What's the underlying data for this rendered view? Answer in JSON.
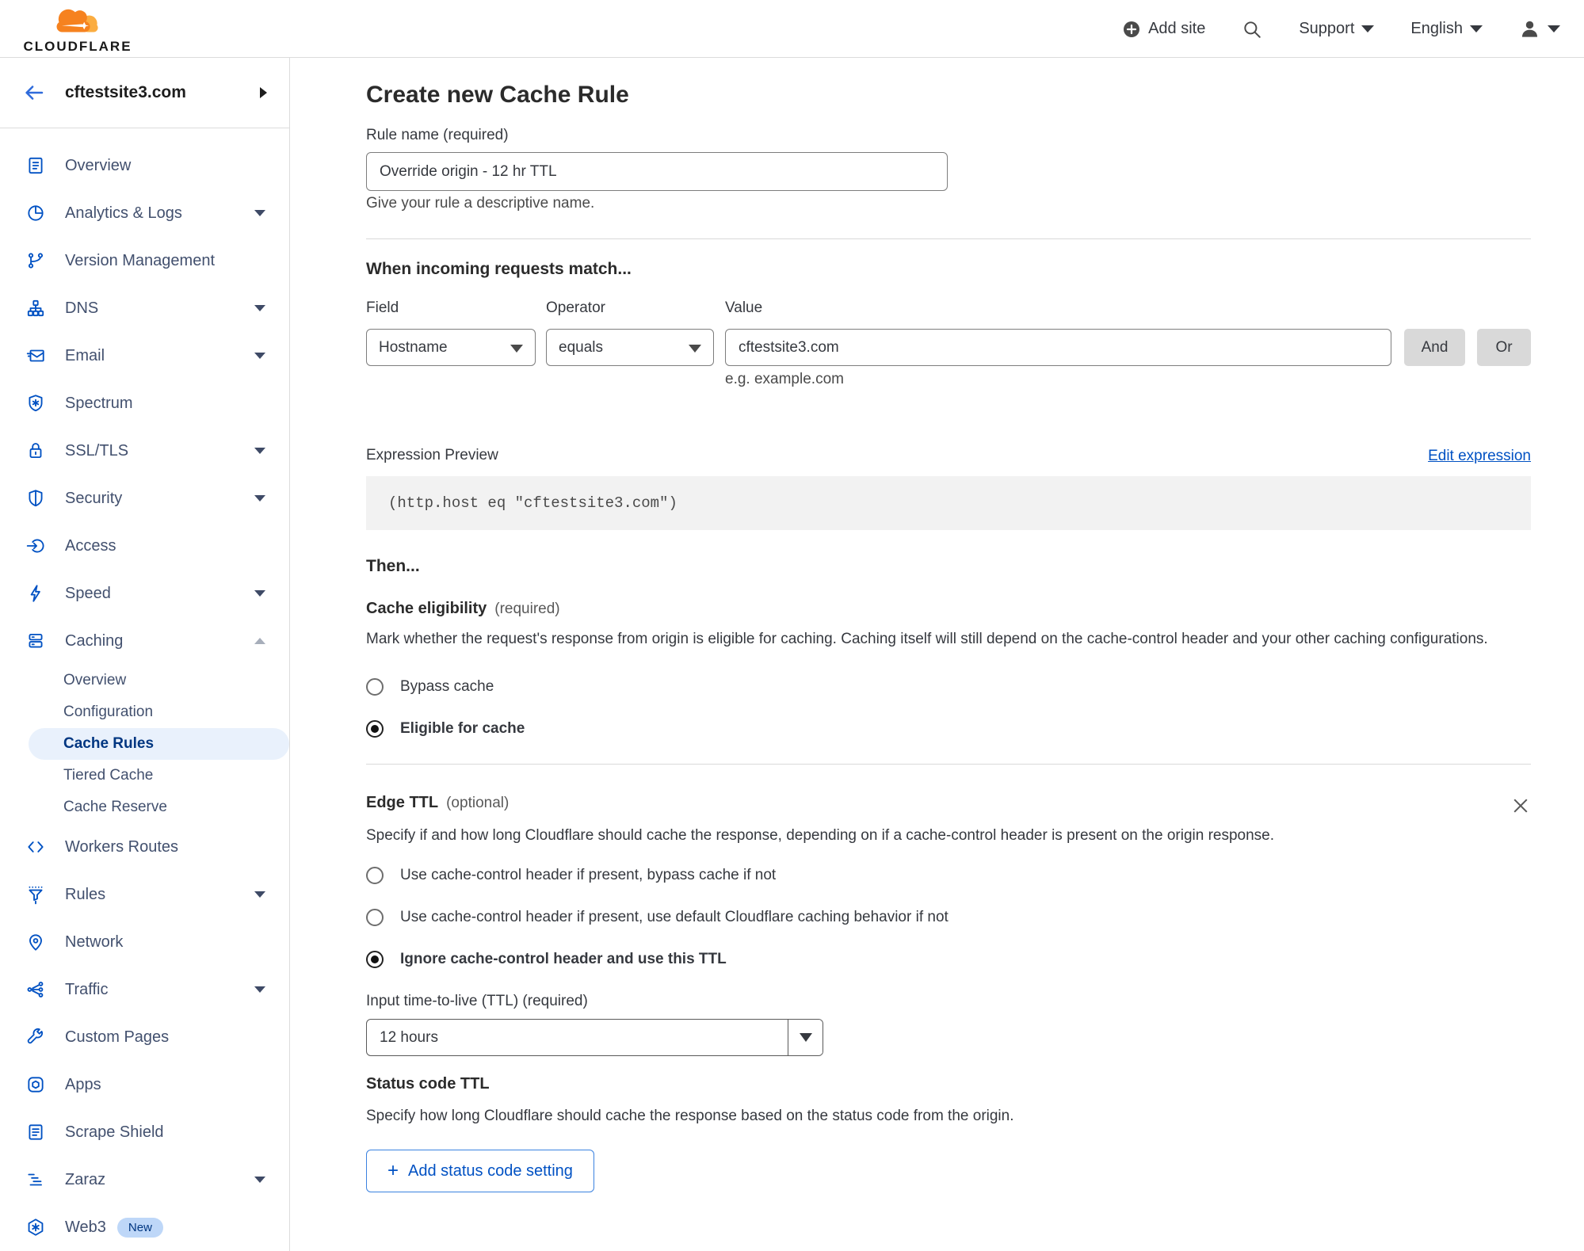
{
  "header": {
    "logo_text": "CLOUDFLARE",
    "add_site_label": "Add site",
    "support_label": "Support",
    "language_label": "English",
    "icons": [
      "plus-circle-icon",
      "search-icon",
      "caret-down-icon",
      "user-icon"
    ]
  },
  "sidebar": {
    "site_name": "cftestsite3.com",
    "back_icon": "back-arrow-icon",
    "expand_icon": "chevron-right-icon",
    "items": [
      {
        "label": "Overview",
        "icon": "clipboard-icon",
        "expandable": false
      },
      {
        "label": "Analytics & Logs",
        "icon": "pie-chart-icon",
        "expandable": true
      },
      {
        "label": "Version Management",
        "icon": "git-branch-icon",
        "expandable": false
      },
      {
        "label": "DNS",
        "icon": "network-tree-icon",
        "expandable": true
      },
      {
        "label": "Email",
        "icon": "envelope-icon",
        "expandable": true
      },
      {
        "label": "Spectrum",
        "icon": "shield-asterisk-icon",
        "expandable": false
      },
      {
        "label": "SSL/TLS",
        "icon": "padlock-icon",
        "expandable": true
      },
      {
        "label": "Security",
        "icon": "shield-icon",
        "expandable": true
      },
      {
        "label": "Access",
        "icon": "login-arrow-icon",
        "expandable": false
      },
      {
        "label": "Speed",
        "icon": "lightning-icon",
        "expandable": true
      },
      {
        "label": "Caching",
        "icon": "server-stack-icon",
        "expandable": true,
        "expanded": true
      },
      {
        "label": "Workers Routes",
        "icon": "code-brackets-icon",
        "expandable": false
      },
      {
        "label": "Rules",
        "icon": "funnel-icon",
        "expandable": true
      },
      {
        "label": "Network",
        "icon": "location-pin-icon",
        "expandable": false
      },
      {
        "label": "Traffic",
        "icon": "share-nodes-icon",
        "expandable": true
      },
      {
        "label": "Custom Pages",
        "icon": "wrench-icon",
        "expandable": false
      },
      {
        "label": "Apps",
        "icon": "app-box-icon",
        "expandable": false
      },
      {
        "label": "Scrape Shield",
        "icon": "document-icon",
        "expandable": false
      },
      {
        "label": "Zaraz",
        "icon": "stacked-bars-icon",
        "expandable": true
      },
      {
        "label": "Web3",
        "icon": "hexagon-snowflake-icon",
        "expandable": false,
        "badge": "New"
      }
    ],
    "caching_subitems": [
      {
        "label": "Overview",
        "active": false
      },
      {
        "label": "Configuration",
        "active": false
      },
      {
        "label": "Cache Rules",
        "active": true
      },
      {
        "label": "Tiered Cache",
        "active": false
      },
      {
        "label": "Cache Reserve",
        "active": false
      }
    ]
  },
  "main": {
    "title": "Create new Cache Rule",
    "rule_name": {
      "label": "Rule name (required)",
      "value": "Override origin - 12 hr TTL",
      "hint": "Give your rule a descriptive name."
    },
    "match": {
      "heading": "When incoming requests match...",
      "field_label": "Field",
      "field_value": "Hostname",
      "operator_label": "Operator",
      "operator_value": "equals",
      "value_label": "Value",
      "value_value": "cftestsite3.com",
      "value_hint": "e.g. example.com",
      "and_label": "And",
      "or_label": "Or"
    },
    "expression": {
      "label": "Expression Preview",
      "edit_link": "Edit expression",
      "code": "(http.host eq \"cftestsite3.com\")"
    },
    "then_heading": "Then...",
    "cache_eligibility": {
      "heading": "Cache eligibility",
      "tag": "(required)",
      "description": "Mark whether the request's response from origin is eligible for caching. Caching itself will still depend on the cache-control header and your other caching configurations.",
      "options": [
        {
          "label": "Bypass cache",
          "selected": false
        },
        {
          "label": "Eligible for cache",
          "selected": true
        }
      ]
    },
    "edge_ttl": {
      "heading": "Edge TTL",
      "tag": "(optional)",
      "close_icon": "close-icon",
      "description": "Specify if and how long Cloudflare should cache the response, depending on if a cache-control header is present on the origin response.",
      "options": [
        {
          "label": "Use cache-control header if present, bypass cache if not",
          "selected": false
        },
        {
          "label": "Use cache-control header if present, use default Cloudflare caching behavior if not",
          "selected": false
        },
        {
          "label": "Ignore cache-control header and use this TTL",
          "selected": true
        }
      ],
      "ttl_label": "Input time-to-live (TTL) (required)",
      "ttl_value": "12 hours",
      "status_code_heading": "Status code TTL",
      "status_code_description": "Specify how long Cloudflare should cache the response based on the status code from the origin.",
      "add_status_button_label": "Add status code setting"
    }
  },
  "colors": {
    "accent_blue": "#0051c3",
    "active_item_bg": "#e9f1fc",
    "active_item_text": "#003681",
    "brand_orange": "#f6821f",
    "brand_orange_light": "#fbad41",
    "code_bg": "#f2f2f2",
    "button_gray": "#d9d9d9"
  }
}
